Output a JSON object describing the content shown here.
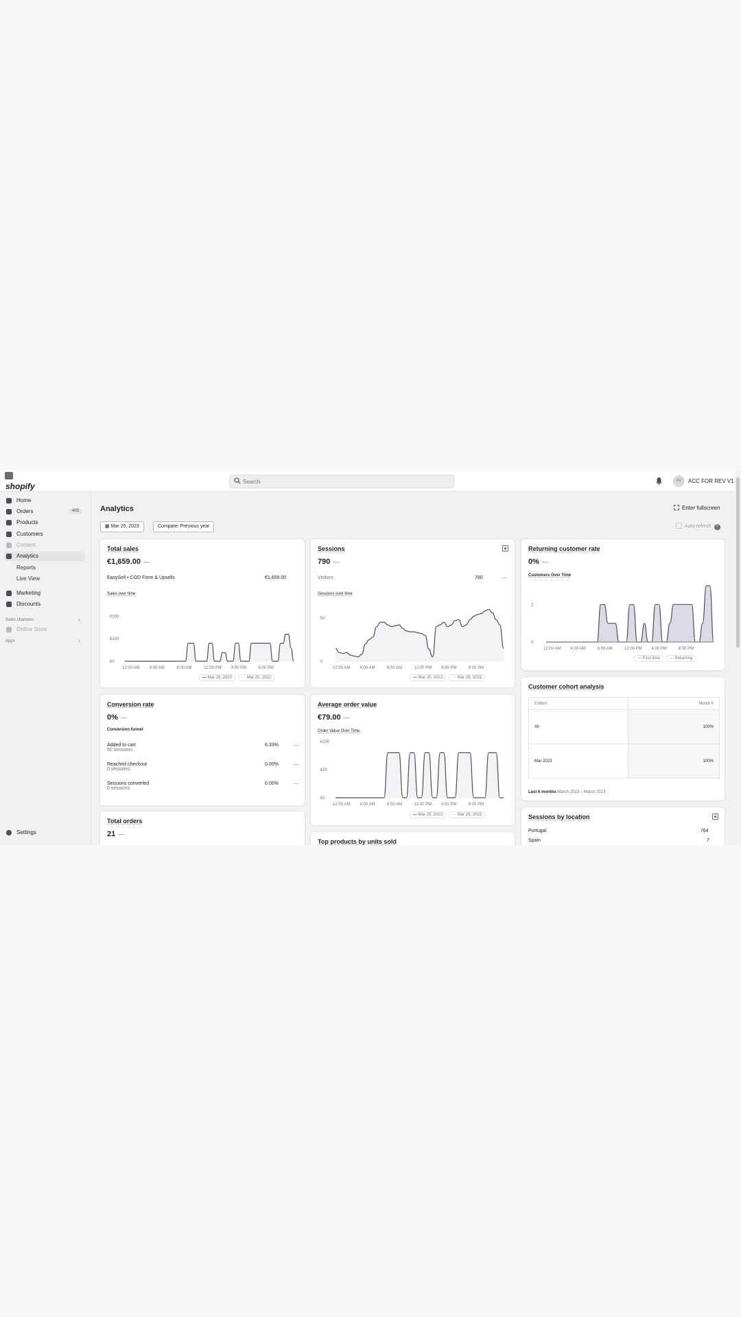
{
  "app": {
    "logo": "shopify",
    "store_name": "ACC FOR REV V1",
    "avatar_initials": "AV",
    "search_placeholder": "Search"
  },
  "sidebar": {
    "items": [
      {
        "label": "Home",
        "icon": "home-icon"
      },
      {
        "label": "Orders",
        "icon": "orders-icon",
        "badge": "403"
      },
      {
        "label": "Products",
        "icon": "tag-icon"
      },
      {
        "label": "Customers",
        "icon": "person-icon"
      },
      {
        "label": "Content",
        "icon": "content-icon"
      },
      {
        "label": "Analytics",
        "icon": "bar-chart-icon"
      },
      {
        "label": "Reports"
      },
      {
        "label": "Live View"
      },
      {
        "label": "Marketing",
        "icon": "target-icon"
      },
      {
        "label": "Discounts",
        "icon": "discount-icon"
      }
    ],
    "sales_channels_label": "Sales channels",
    "online_store_label": "Online Store",
    "apps_label": "Apps",
    "settings_label": "Settings"
  },
  "page": {
    "title": "Analytics",
    "fullscreen_label": "Enter fullscreen",
    "date_label": "Mar 25, 2023",
    "compare_label": "Compare: Previous year",
    "auto_refresh_label": "Auto-refresh"
  },
  "legend": {
    "current": "Mar 25, 2023",
    "previous": "Mar 25, 2022"
  },
  "total_sales": {
    "title": "Total sales",
    "value": "€1,659.00",
    "dash": "—",
    "row_label": "EasySell • COD Form & Upsells",
    "row_value": "€1,659.00",
    "chart_label": "Sales over time"
  },
  "sessions": {
    "title": "Sessions",
    "value": "790",
    "dash": "—",
    "row_label": "Visitors",
    "row_value": "780",
    "row_dash": "—",
    "chart_label": "Sessions over time"
  },
  "returning": {
    "title": "Returning customer rate",
    "value": "0%",
    "dash": "—",
    "chart_label": "Customers Over Time",
    "legend_first": "First-time",
    "legend_returning": "Returning"
  },
  "conversion": {
    "title": "Conversion rate",
    "value": "0%",
    "dash": "—",
    "funnel_label": "Conversion funnel",
    "rows": [
      {
        "label": "Added to cart",
        "sub": "50 sessions",
        "pct": "6.33%",
        "dash": "—"
      },
      {
        "label": "Reached checkout",
        "sub": "0 sessions",
        "pct": "0.00%",
        "dash": "—"
      },
      {
        "label": "Sessions converted",
        "sub": "0 sessions",
        "pct": "0.00%",
        "dash": "—"
      }
    ]
  },
  "aov": {
    "title": "Average order value",
    "value": "€79.00",
    "dash": "—",
    "chart_label": "Order Value Over Time"
  },
  "cohort": {
    "title": "Customer cohort analysis",
    "header": [
      "Cohort",
      "Month 0"
    ],
    "rows": [
      [
        "All",
        "100%"
      ],
      [
        "Mar 2023",
        "100%"
      ]
    ],
    "footer_bold": "Last 6 months",
    "footer_range": "March 2023 – March 2023"
  },
  "total_orders": {
    "title": "Total orders",
    "value": "21",
    "dash": "—"
  },
  "top_products": {
    "title": "Top products by units sold"
  },
  "location": {
    "title": "Sessions by location",
    "rows": [
      {
        "label": "Portugal",
        "value": "764"
      },
      {
        "label": "Spain",
        "value": "7"
      }
    ]
  },
  "chart_data": [
    {
      "type": "line",
      "title": "Sales over time",
      "x_ticks": [
        "12:00 AM",
        "4:00 AM",
        "8:00 AM",
        "12:00 PM",
        "4:00 PM",
        "8:00 PM"
      ],
      "y_ticks": [
        "€200",
        "€100",
        "€0"
      ],
      "ylim": [
        0,
        250
      ],
      "series": [
        {
          "name": "Mar 25, 2023",
          "values": [
            0,
            0,
            0,
            0,
            0,
            0,
            0,
            0,
            0,
            0,
            0,
            0,
            0,
            0,
            0,
            0,
            0,
            0,
            0,
            0,
            0,
            0,
            0,
            0,
            80,
            80,
            80,
            0,
            0,
            0,
            0,
            0,
            80,
            80,
            0,
            0,
            0,
            38,
            38,
            0,
            0,
            0,
            80,
            80,
            0,
            0,
            0,
            0,
            80,
            80,
            80,
            80,
            80,
            80,
            80,
            80,
            0,
            0,
            0,
            80,
            80,
            120,
            120,
            60,
            0
          ]
        }
      ]
    },
    {
      "type": "line",
      "title": "Sessions over time",
      "x_ticks": [
        "12:00 AM",
        "4:00 AM",
        "8:00 AM",
        "12:00 PM",
        "4:00 PM",
        "8:00 PM"
      ],
      "y_ticks": [
        "50",
        "0"
      ],
      "ylim": [
        0,
        65
      ],
      "series": [
        {
          "name": "Mar 25, 2023",
          "values": [
            15,
            10,
            9,
            10,
            7,
            6,
            5,
            8,
            20,
            25,
            28,
            40,
            45,
            45,
            42,
            40,
            41,
            42,
            38,
            35,
            34,
            34,
            33,
            32,
            30,
            14,
            5,
            40,
            42,
            45,
            40,
            42,
            47,
            48,
            40,
            42,
            48,
            52,
            54,
            55,
            58,
            60,
            56,
            48,
            42,
            15
          ]
        }
      ]
    },
    {
      "type": "area",
      "title": "Customers Over Time",
      "x_ticks": [
        "12:00 AM",
        "4:00 AM",
        "8:00 AM",
        "12:00 PM",
        "4:00 PM",
        "8:00 PM"
      ],
      "y_ticks": [
        "2",
        "0"
      ],
      "ylim": [
        0,
        3
      ],
      "series": [
        {
          "name": "First-time",
          "values": [
            0,
            0,
            0,
            0,
            0,
            0,
            0,
            0,
            0,
            0,
            0,
            0,
            0,
            0,
            0,
            2,
            2,
            1,
            1,
            1,
            0,
            0,
            0,
            2,
            2,
            0,
            0,
            1,
            0,
            0,
            2,
            2,
            0,
            0,
            1,
            2,
            2,
            2,
            2,
            2,
            2,
            0,
            0,
            1,
            3,
            3,
            0
          ]
        },
        {
          "name": "Returning",
          "values": [
            0,
            0,
            0,
            0,
            0,
            0,
            0,
            0,
            0,
            0,
            0,
            0,
            0,
            0,
            0,
            0,
            0,
            0,
            0,
            0,
            0,
            0,
            0,
            0,
            0,
            0,
            0,
            0,
            0,
            0,
            0,
            0,
            0,
            0,
            0,
            0,
            0,
            0,
            0,
            0,
            0,
            0,
            0,
            0,
            0,
            0,
            0
          ]
        }
      ]
    },
    {
      "type": "line",
      "title": "Order Value Over Time",
      "x_ticks": [
        "12:00 AM",
        "4:00 AM",
        "8:00 AM",
        "12:00 PM",
        "4:00 PM",
        "8:00 PM"
      ],
      "y_ticks": [
        "€100",
        "€50",
        "€0"
      ],
      "ylim": [
        0,
        100
      ],
      "series": [
        {
          "name": "Mar 25, 2023",
          "values": [
            0,
            0,
            0,
            0,
            0,
            0,
            0,
            0,
            0,
            0,
            0,
            0,
            0,
            0,
            80,
            80,
            80,
            80,
            0,
            0,
            80,
            80,
            0,
            0,
            80,
            80,
            0,
            0,
            80,
            80,
            0,
            0,
            0,
            80,
            80,
            80,
            80,
            0,
            0,
            0,
            0,
            80,
            80,
            80,
            0,
            0
          ]
        }
      ]
    }
  ]
}
